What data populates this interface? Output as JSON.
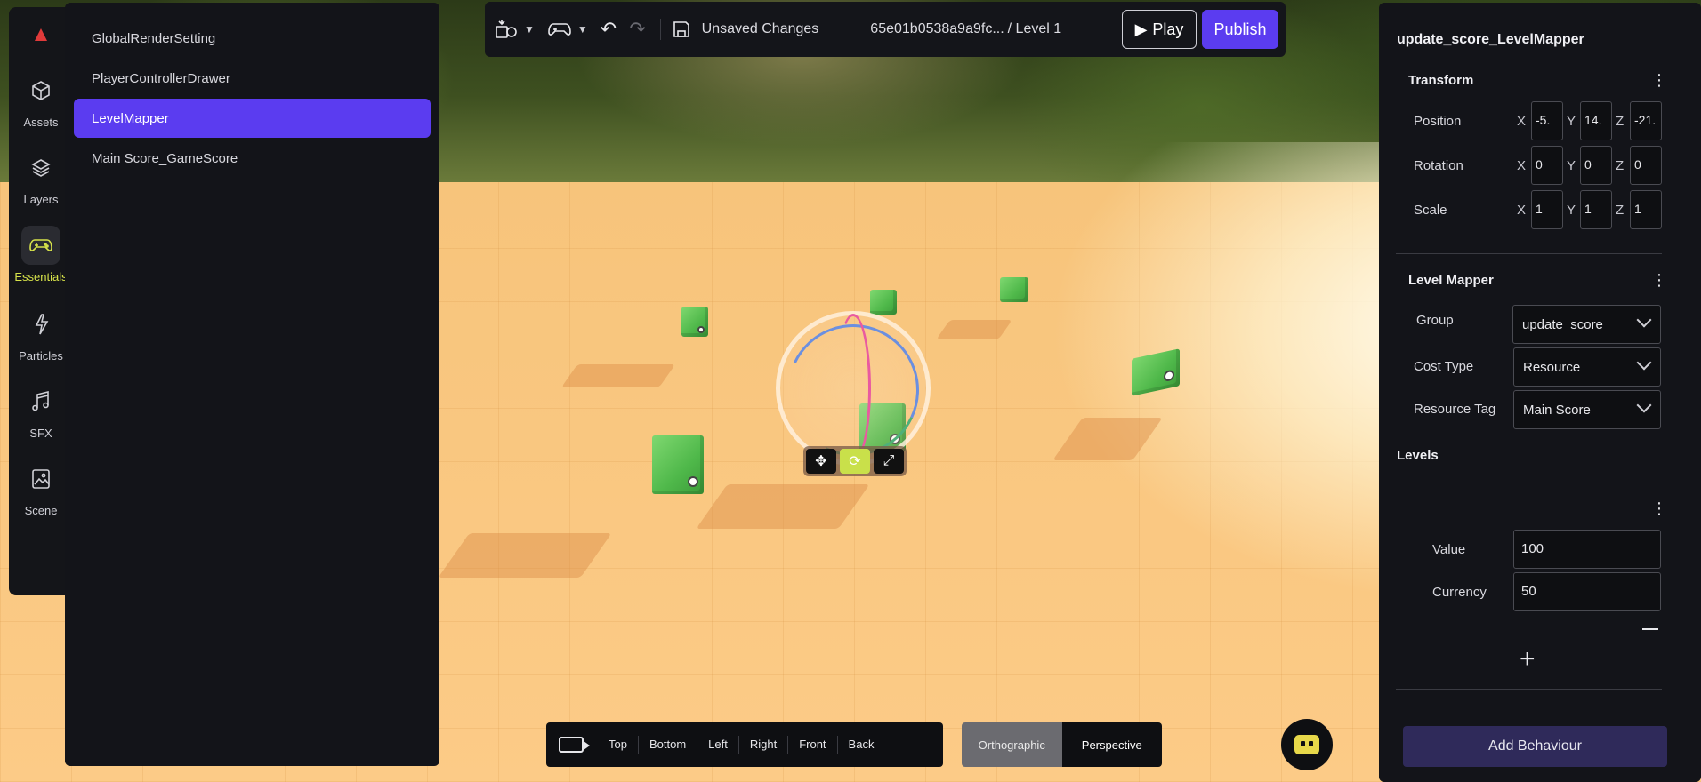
{
  "app": {
    "logo_icon": "brand-logo-icon",
    "accent": "#5b3cf0",
    "highlight": "#d7e34a"
  },
  "rail": {
    "items": [
      {
        "label": "Assets",
        "icon": "cube-icon"
      },
      {
        "label": "Layers",
        "icon": "layers-icon"
      },
      {
        "label": "Essentials",
        "icon": "gamepad-icon"
      },
      {
        "label": "Particles",
        "icon": "sparkle-icon"
      },
      {
        "label": "SFX",
        "icon": "music-note-icon"
      },
      {
        "label": "Scene",
        "icon": "image-icon"
      }
    ],
    "active": "Essentials"
  },
  "layers": {
    "items": [
      {
        "label": "GlobalRenderSetting"
      },
      {
        "label": "PlayerControllerDrawer"
      },
      {
        "label": "LevelMapper"
      },
      {
        "label": "Main Score_GameScore"
      }
    ],
    "selected": "LevelMapper"
  },
  "toolbar": {
    "status": "Unsaved Changes",
    "breadcrumb_id": "65e01b0538a9a9fc...",
    "breadcrumb_level": "/ Level 1",
    "play_label": "Play",
    "publish_label": "Publish"
  },
  "inspector": {
    "object_name": "update_score_LevelMapper",
    "transform": {
      "title": "Transform",
      "position": {
        "label": "Position",
        "x": "-5.",
        "y": "14.",
        "z": "-21."
      },
      "rotation": {
        "label": "Rotation",
        "x": "0",
        "y": "0",
        "z": "0"
      },
      "scale": {
        "label": "Scale",
        "x": "1",
        "y": "1",
        "z": "1"
      },
      "axis_x": "X",
      "axis_y": "Y",
      "axis_z": "Z"
    },
    "level_mapper": {
      "title": "Level Mapper",
      "group_label": "Group",
      "group_value": "update_score",
      "cost_type_label": "Cost Type",
      "cost_type_value": "Resource",
      "resource_tag_label": "Resource Tag",
      "resource_tag_value": "Main Score"
    },
    "levels": {
      "title": "Levels",
      "value_label": "Value",
      "value": "100",
      "currency_label": "Currency",
      "currency": "50"
    },
    "add_behaviour_label": "Add Behaviour"
  },
  "camera_bar": {
    "views": [
      "Top",
      "Bottom",
      "Left",
      "Right",
      "Front",
      "Back"
    ],
    "projection": [
      "Orthographic",
      "Perspective"
    ],
    "active_projection": "Orthographic"
  }
}
